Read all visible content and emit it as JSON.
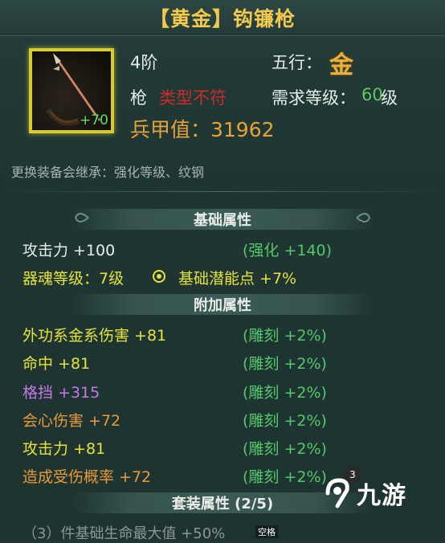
{
  "title": "【黄金】钩镰枪",
  "item": {
    "level_badge": "+70",
    "tier": "4阶",
    "element_label": "五行：",
    "element_value": "金",
    "weapon_type": "枪",
    "type_warning": "类型不符",
    "req_level_label": "需求等级：",
    "req_level_value": "60",
    "req_level_unit": "级",
    "power_label": "兵甲值：31962",
    "inherit_note": "更换装备会继承：强化等级、纹钢"
  },
  "basic": {
    "header": "基础属性",
    "attack": "攻击力 +100",
    "attack_bonus": "(强化 +140)",
    "soul_level": "器魂等级：7级",
    "potential": "基础潜能点 +7%"
  },
  "extra": {
    "header": "附加属性",
    "rows": [
      {
        "name": "外功系金系伤害 +81",
        "note": "(雕刻 +2%)"
      },
      {
        "name": "命中 +81",
        "note": "(雕刻 +2%)"
      },
      {
        "name": "格挡 +315",
        "note": "(雕刻 +2%)"
      },
      {
        "name": "会心伤害 +72",
        "note": "(雕刻 +2%)"
      },
      {
        "name": "攻击力 +81",
        "note": "(雕刻 +2%)"
      },
      {
        "name": "造成受伤概率 +72",
        "note": "(雕刻 +2%)"
      }
    ]
  },
  "set": {
    "header": "套装属性 (2/5)",
    "line": "（3）件基础生命最大值 +50%"
  },
  "overlay": {
    "badge": "3",
    "watermark": "九游",
    "space_tag": "空格"
  },
  "colors": {
    "title": "#f2c94c",
    "gold": "#e8a23a",
    "yellow": "#e6e33a",
    "purple": "#c977e6",
    "orange": "#e89a3a",
    "green": "#55c86a",
    "red": "#cc2b2b"
  }
}
